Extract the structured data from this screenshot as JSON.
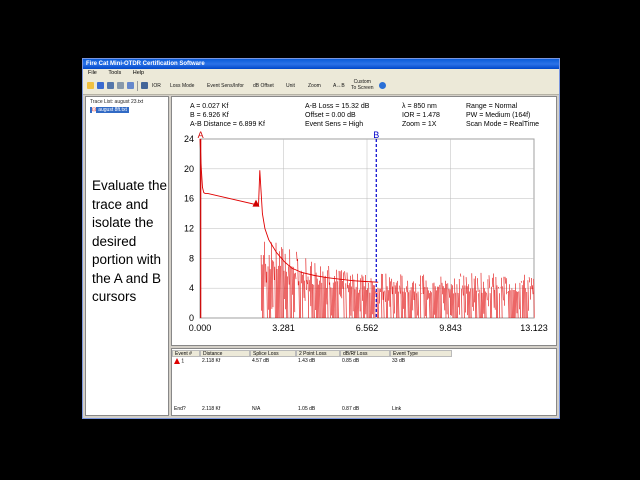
{
  "window": {
    "title": "Fire Cat Mini-OTDR Certification Software"
  },
  "menu": [
    "File",
    "Tools",
    "Help"
  ],
  "toolbar": {
    "ior": "IOR",
    "loss_mode": "Loss Mode",
    "event_sens": "Event Sens/Infor",
    "db_offset": "dB Offset",
    "unit": "Unit",
    "zoom": "Zoom",
    "ab": "A↔B",
    "custom_line1": "Custom",
    "custom_line2": "To Screen"
  },
  "tree": {
    "root": "Trace List: august 23.txt",
    "item": "august 8ft.txt"
  },
  "instruction": "Evaluate the trace and isolate the desired portion with the A and B cursors",
  "info": {
    "a": "A = 0.027 Kf",
    "b": "B = 6.926 Kf",
    "ab_distance": "A-B Distance = 6.899 Kf",
    "ab_loss": "A-B Loss = 15.32 dB",
    "offset": "Offset = 0.00 dB",
    "event_sens": "Event Sens = High",
    "lambda": "λ = 850 nm",
    "ior": "IOR = 1.478",
    "zoom": "Zoom = 1X",
    "range": "Range = Normal",
    "pw": "PW = Medium (164f)",
    "scan_mode": "Scan Mode = RealTime"
  },
  "chart_data": {
    "type": "line",
    "xlim": [
      0,
      13.123
    ],
    "ylim": [
      0,
      24
    ],
    "x_ticks": [
      "0.000",
      "3.281",
      "6.562",
      "9.843",
      "13.123"
    ],
    "y_ticks": [
      "0",
      "4",
      "8",
      "12",
      "16",
      "20",
      "24"
    ],
    "grid": true,
    "cursor_a_x": 0.027,
    "cursor_b_x": 6.926,
    "cursor_a_label": "A",
    "cursor_b_label": "B",
    "series": [
      {
        "color": "#e00000",
        "x": [
          0.0,
          0.05,
          0.1,
          0.15,
          0.2,
          0.3,
          2.2,
          2.3,
          2.35,
          2.45,
          2.55,
          2.7,
          3.0,
          3.3,
          3.6,
          4.0,
          4.5,
          5.0,
          5.5,
          6.0,
          6.5,
          7.0
        ],
        "y": [
          24.0,
          20.0,
          17.5,
          16.8,
          16.7,
          16.7,
          15.2,
          15.0,
          19.8,
          14.0,
          12.0,
          10.5,
          8.8,
          7.6,
          6.7,
          6.1,
          5.7,
          5.4,
          5.2,
          5.0,
          4.9,
          4.8
        ]
      }
    ],
    "noise_after_x": 2.4,
    "noise_floor": 0.0
  },
  "table": {
    "headers": [
      "Event #",
      "Distance",
      "Splice Loss",
      "2 Point Loss",
      "dB/Rf Loss",
      "Event Type"
    ],
    "rows": [
      [
        "1",
        "2.118 Kf",
        "4.57 dB",
        "1.43 dB",
        "0.85 dB",
        "33 dB"
      ]
    ],
    "footer": [
      "End?",
      "2.118 Kf",
      "N/A",
      "1.05 dB",
      "0.87 dB",
      "Link"
    ]
  }
}
